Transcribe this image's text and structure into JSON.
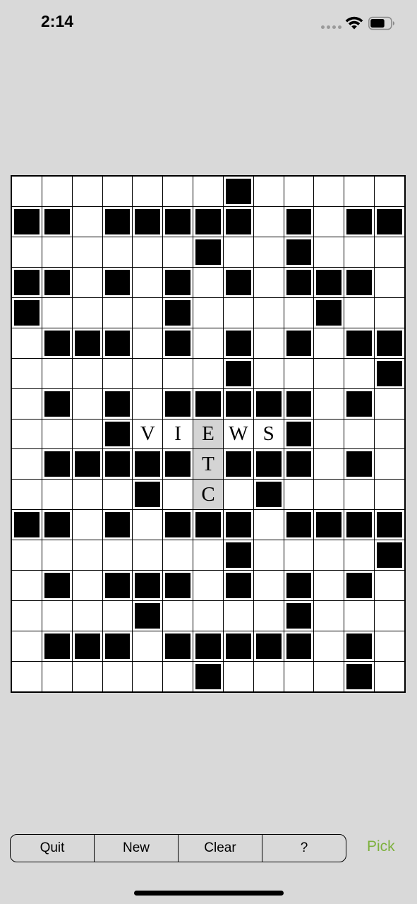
{
  "status_bar": {
    "time": "2:14",
    "icons": [
      "signal-dots-icon",
      "wifi-icon",
      "battery-icon"
    ]
  },
  "grid": {
    "rows": [
      ".......#.....",
      "##.#####.#.##",
      "......#..#...",
      "##.#.#.#.###.",
      "#....#....#..",
      ".###.#.#.#.##",
      ".......#....#",
      ".#.#.#####.#.",
      "...#VIEWS#...",
      ".#####T###.#.",
      "....#.C.#....",
      "##.#.###.####",
      ".......#....#",
      ".#.###.#.#.#.",
      "....#....#...",
      ".###.#####.#.",
      "......#....#."
    ],
    "highlighted": [
      [
        8,
        6
      ],
      [
        9,
        6
      ],
      [
        10,
        6
      ]
    ]
  },
  "toolbar": {
    "buttons": [
      "Quit",
      "New",
      "Clear",
      "?"
    ]
  },
  "pick": {
    "label": "Pick",
    "color": "#7db13d"
  }
}
